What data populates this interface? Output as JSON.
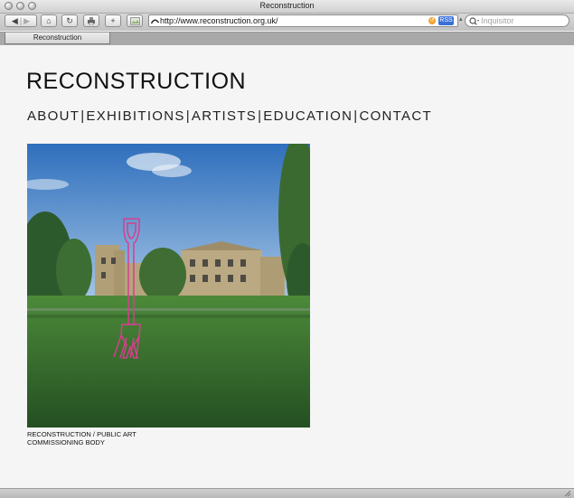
{
  "window": {
    "title": "Reconstruction"
  },
  "toolbar": {
    "url": "http://www.reconstruction.org.uk/",
    "rss_label": "RSS",
    "search_placeholder": "Inquisitor"
  },
  "tabs": [
    {
      "label": "Reconstruction"
    }
  ],
  "page": {
    "site_title": "RECONSTRUCTION",
    "nav": [
      "ABOUT",
      "EXHIBITIONS",
      "ARTISTS",
      "EDUCATION",
      "CONTACT"
    ],
    "nav_separator": "|",
    "caption_line1": "RECONSTRUCTION / PUBLIC ART",
    "caption_line2": "COMMISSIONING BODY"
  },
  "colors": {
    "fork_outline": "#d63f8f",
    "sky": "#4d86c9",
    "lawn": "#2f6b2a"
  }
}
